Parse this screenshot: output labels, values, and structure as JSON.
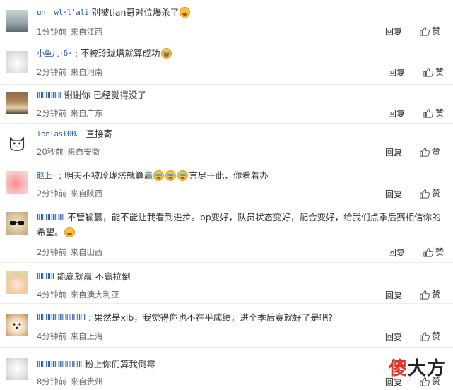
{
  "comments": [
    {
      "username": "un  wl·l'ali",
      "text": "别被tian哥对位爆杀了",
      "emoji_after": "grin",
      "time": "1分钟前",
      "source": "来自江西",
      "reply": "回复",
      "like": "赞"
    },
    {
      "username": "小鱼儿·δ·",
      "text": ": 不被玲珑塔就算成功",
      "emoji_after": "tears",
      "time": "2分钟前",
      "source": "来自河南",
      "reply": "回复",
      "like": "赞"
    },
    {
      "username": "ⅡⅡⅡⅡⅡⅡⅡ",
      "text": "谢谢你 已经觉得没了",
      "time": "2分钟前",
      "source": "来自广东",
      "reply": "回复",
      "like": "赞"
    },
    {
      "username": "lanlasl00、",
      "text": "直接寄",
      "time": "20秒前",
      "source": "来自安徽",
      "reply": "回复",
      "like": "赞"
    },
    {
      "username": "赵上·",
      "text_before": ": 明天不被玲珑塔就算赢",
      "text_after": "言尽于此，你看着办",
      "time": "2分钟前",
      "source": "来自陕西",
      "reply": "回复",
      "like": "赞"
    },
    {
      "username": "ⅡⅡⅡⅡⅡⅡⅡⅡ",
      "text": "不管输赢，能不能让我看到进步。bp变好，队员状态变好，配合变好，给我们点季后赛相信你的希望。",
      "time": "2分钟前",
      "source": "来自山西",
      "reply": "回复",
      "like": "赞"
    },
    {
      "username": "ⅡⅡⅡⅡⅡ",
      "text": "能赢就赢 不赢拉倒",
      "time": "4分钟前",
      "source": "来自澳大利亚",
      "reply": "回复",
      "like": "赞"
    },
    {
      "username": "ⅡⅡⅡⅡⅡⅡⅡⅡⅡⅡⅡⅡⅡⅡ",
      "text": ": 果然是xlb，我觉得你也不在乎成绩，进个季后赛就好了是吧?",
      "time": "4分钟前",
      "source": "来自上海",
      "reply": "回复",
      "like": "赞"
    },
    {
      "username": "ⅡⅡⅡⅡⅡⅡⅡⅡⅡⅡⅡⅡⅡ",
      "text": "粉上你们算我倒霉",
      "time": "8分钟前",
      "source": "来自贵州",
      "reply": "回复",
      "like": "赞"
    }
  ],
  "watermark": {
    "part1": "傻",
    "part2": "大方"
  }
}
